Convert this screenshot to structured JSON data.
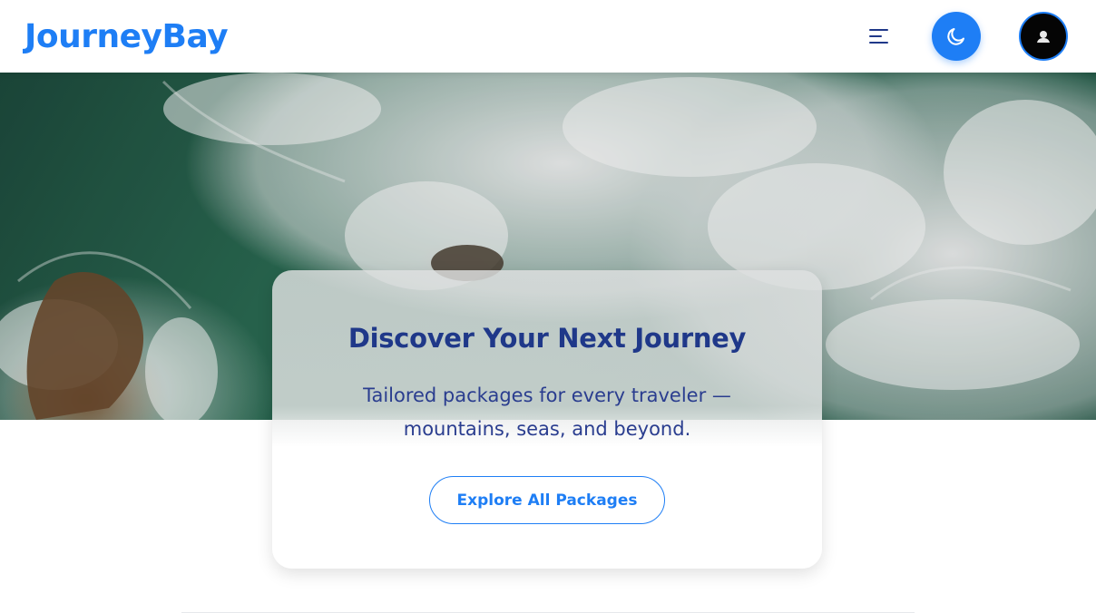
{
  "header": {
    "logo": "JourneyBay",
    "menu_icon": "menu-icon",
    "theme_icon": "moon-icon",
    "avatar_icon": "user-avatar-icon"
  },
  "hero": {
    "image": "aerial ocean waves over rocks"
  },
  "card": {
    "title": "Discover Your Next Journey",
    "subtitle": "Tailored packages for every traveler — mountains, seas, and beyond.",
    "button_label": "Explore All Packages"
  },
  "colors": {
    "accent": "#1e7ef5",
    "title": "#1f3889",
    "subtitle": "#2a3d8f"
  }
}
